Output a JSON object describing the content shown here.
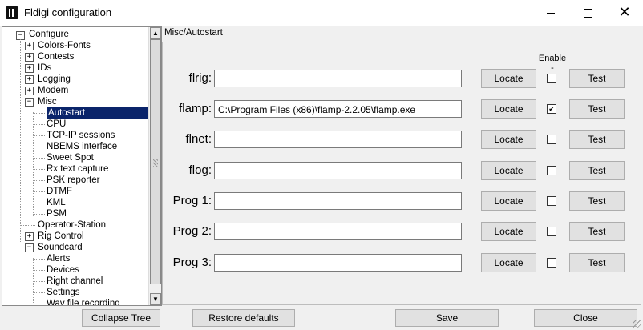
{
  "window": {
    "title": "Fldigi configuration",
    "min": "—",
    "max": "□",
    "close": "✕"
  },
  "tree": {
    "root": "Configure",
    "items": [
      {
        "label": "Colors-Fonts",
        "expander": "+"
      },
      {
        "label": "Contests",
        "expander": "+"
      },
      {
        "label": "IDs",
        "expander": "+"
      },
      {
        "label": "Logging",
        "expander": "+"
      },
      {
        "label": "Modem",
        "expander": "+"
      },
      {
        "label": "Misc",
        "expander": "−"
      },
      {
        "label": "Autostart"
      },
      {
        "label": "CPU"
      },
      {
        "label": "TCP-IP sessions"
      },
      {
        "label": "NBEMS interface"
      },
      {
        "label": "Sweet Spot"
      },
      {
        "label": "Rx text capture"
      },
      {
        "label": "PSK reporter"
      },
      {
        "label": "DTMF"
      },
      {
        "label": "KML"
      },
      {
        "label": "PSM"
      },
      {
        "label": "Operator-Station"
      },
      {
        "label": "Rig Control",
        "expander": "+"
      },
      {
        "label": "Soundcard",
        "expander": "−"
      },
      {
        "label": "Alerts"
      },
      {
        "label": "Devices"
      },
      {
        "label": "Right channel"
      },
      {
        "label": "Settings"
      },
      {
        "label": "Wav file recording"
      }
    ]
  },
  "panel": {
    "title": "Misc/Autostart",
    "enable_header": "Enable",
    "enable_header_dash": "-",
    "rows": [
      {
        "label": "flrig:",
        "path": "",
        "locate": "Locate",
        "test": "Test",
        "checked": false,
        "check_glyph": ""
      },
      {
        "label": "flamp:",
        "path": "C:\\Program Files (x86)\\flamp-2.2.05\\flamp.exe",
        "locate": "Locate",
        "test": "Test",
        "checked": true,
        "check_glyph": "✔"
      },
      {
        "label": "flnet:",
        "path": "",
        "locate": "Locate",
        "test": "Test",
        "checked": false,
        "check_glyph": ""
      },
      {
        "label": "flog:",
        "path": "",
        "locate": "Locate",
        "test": "Test",
        "checked": false,
        "check_glyph": ""
      },
      {
        "label": "Prog 1:",
        "path": "",
        "locate": "Locate",
        "test": "Test",
        "checked": false,
        "check_glyph": ""
      },
      {
        "label": "Prog 2:",
        "path": "",
        "locate": "Locate",
        "test": "Test",
        "checked": false,
        "check_glyph": ""
      },
      {
        "label": "Prog 3:",
        "path": "",
        "locate": "Locate",
        "test": "Test",
        "checked": false,
        "check_glyph": ""
      }
    ]
  },
  "footer": {
    "collapse": "Collapse Tree",
    "restore": "Restore defaults",
    "save": "Save",
    "close": "Close"
  }
}
